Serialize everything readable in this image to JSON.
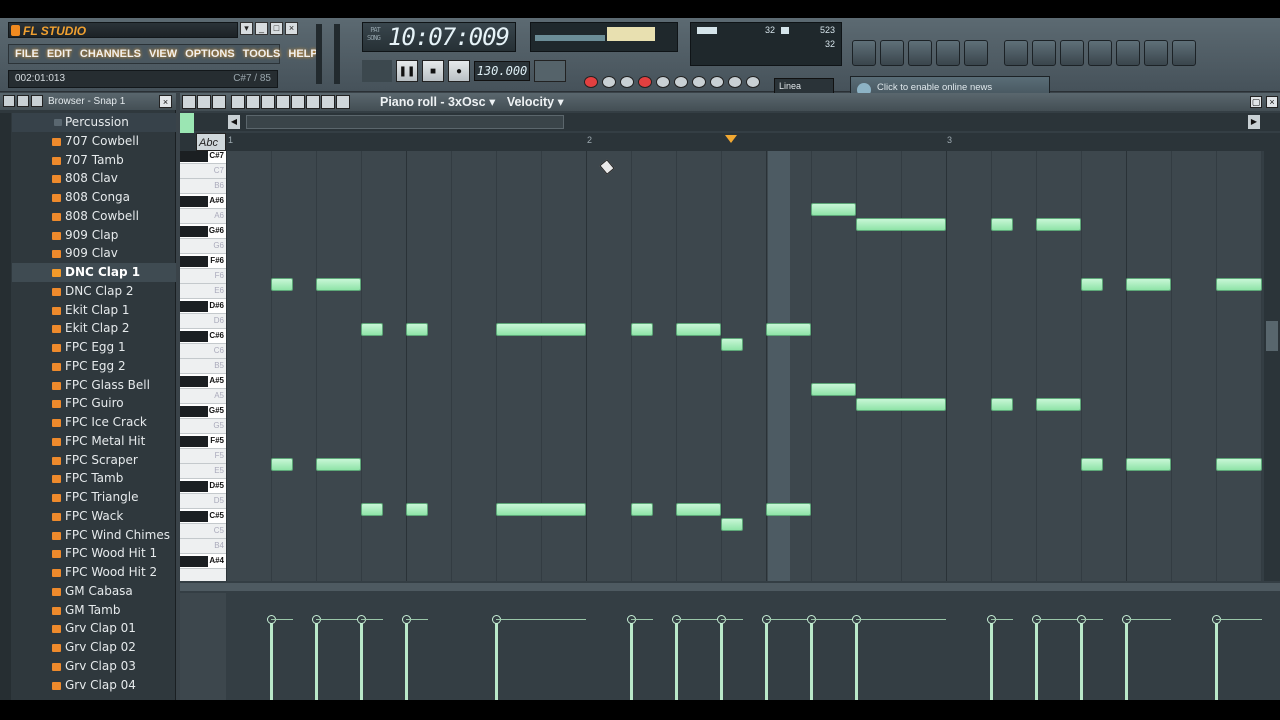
{
  "app": {
    "title": "FL STUDIO"
  },
  "menu": [
    "FILE",
    "EDIT",
    "CHANNELS",
    "VIEW",
    "OPTIONS",
    "TOOLS",
    "HELP"
  ],
  "status": {
    "position": "002:01:013",
    "hint": "C#7 / 85"
  },
  "clock": {
    "time": "10:07:009"
  },
  "transport": {
    "tempo": "130.000"
  },
  "cpu": {
    "v1": "32",
    "v2": "523",
    "v3": "32"
  },
  "snap": {
    "label": "Linea"
  },
  "news": {
    "text": "Click to enable online news"
  },
  "browser": {
    "header": "Browser - Snap 1",
    "items": [
      {
        "label": "Percussion",
        "type": "folder"
      },
      {
        "label": "707 Cowbell"
      },
      {
        "label": "707 Tamb"
      },
      {
        "label": "808 Clav"
      },
      {
        "label": "808 Conga"
      },
      {
        "label": "808 Cowbell"
      },
      {
        "label": "909 Clap"
      },
      {
        "label": "909 Clav"
      },
      {
        "label": "DNC Clap 1",
        "selected": true
      },
      {
        "label": "DNC Clap 2"
      },
      {
        "label": "Ekit Clap 1"
      },
      {
        "label": "Ekit Clap 2"
      },
      {
        "label": "FPC Egg 1"
      },
      {
        "label": "FPC Egg 2"
      },
      {
        "label": "FPC Glass Bell"
      },
      {
        "label": "FPC Guiro"
      },
      {
        "label": "FPC Ice Crack"
      },
      {
        "label": "FPC Metal Hit"
      },
      {
        "label": "FPC Scraper"
      },
      {
        "label": "FPC Tamb"
      },
      {
        "label": "FPC Triangle"
      },
      {
        "label": "FPC Wack"
      },
      {
        "label": "FPC Wind Chimes"
      },
      {
        "label": "FPC Wood Hit 1"
      },
      {
        "label": "FPC Wood Hit 2"
      },
      {
        "label": "GM Cabasa"
      },
      {
        "label": "GM Tamb"
      },
      {
        "label": "Grv Clap 01"
      },
      {
        "label": "Grv Clap 02"
      },
      {
        "label": "Grv Clap 03"
      },
      {
        "label": "Grv Clap 04"
      }
    ]
  },
  "pianoroll": {
    "title": "Piano roll - 3xOsc",
    "target": "Velocity",
    "timeline": [
      "1",
      "2",
      "3"
    ],
    "key_labels": [
      "C#7",
      "C7",
      "B6",
      "A#6",
      "A6",
      "G#6",
      "G6",
      "F#6",
      "F6",
      "E6",
      "D#6",
      "D6",
      "C#6",
      "C6",
      "B5",
      "A#5",
      "A5",
      "G#5",
      "G5",
      "F#5",
      "F5",
      "E5",
      "D#5",
      "D5",
      "C#5",
      "C5",
      "B4",
      "A#4"
    ],
    "abc": "Abc"
  }
}
